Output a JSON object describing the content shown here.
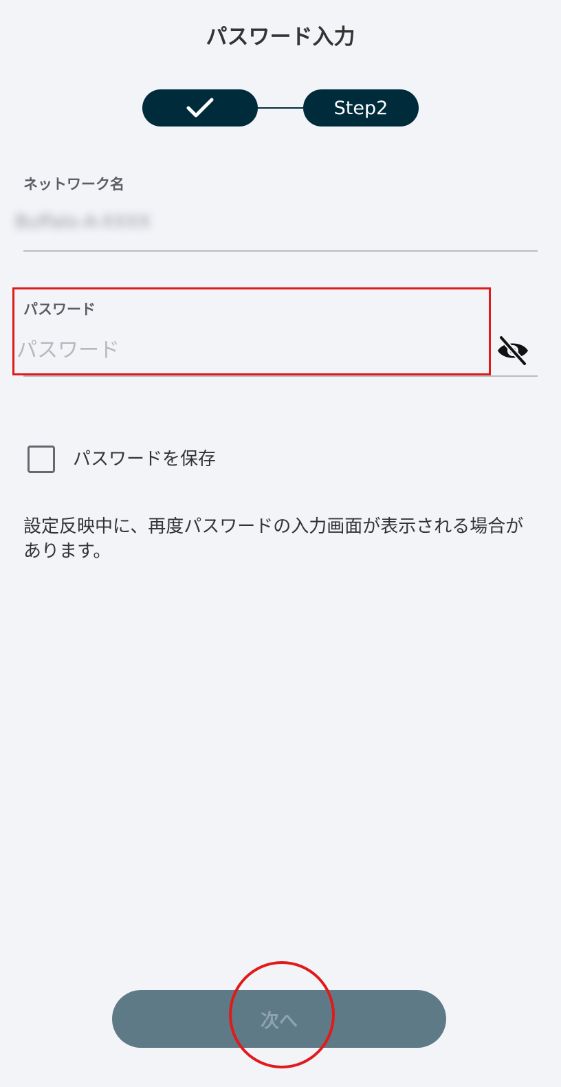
{
  "header": {
    "title": "パスワード入力"
  },
  "stepper": {
    "step1_icon": "checkmark-icon",
    "step2_label": "Step2",
    "active_color": "#002b3b"
  },
  "network": {
    "label": "ネットワーク名",
    "value": "Buffalo-A-XXXX"
  },
  "password": {
    "label": "パスワード",
    "placeholder": "パスワード",
    "value": "",
    "toggle_icon": "eye-off-icon"
  },
  "save_password": {
    "label": "パスワードを保存",
    "checked": false
  },
  "notice": {
    "text": "設定反映中に、再度パスワードの入力画面が表示される場合があります。"
  },
  "footer": {
    "next_label": "次へ",
    "disabled": true
  },
  "colors": {
    "background": "#f3f4f8",
    "button": "#5f7a87",
    "annotation": "#e01a1a"
  }
}
